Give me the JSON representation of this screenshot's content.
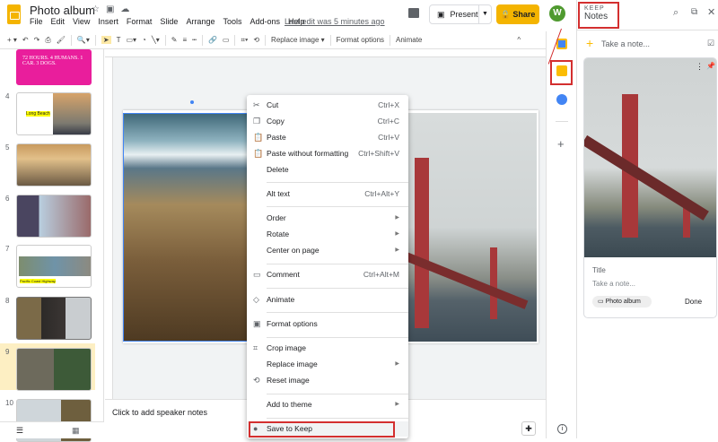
{
  "header": {
    "title": "Photo album",
    "menu": [
      "File",
      "Edit",
      "View",
      "Insert",
      "Format",
      "Slide",
      "Arrange",
      "Tools",
      "Add-ons",
      "Help"
    ],
    "last_edit": "Last edit was 5 minutes ago",
    "present": "Present",
    "share": "Share",
    "avatar": "W"
  },
  "toolbar": {
    "replace_image": "Replace image ▾",
    "format_options": "Format options",
    "animate": "Animate"
  },
  "filmstrip": {
    "slide3_text": "72 HOURS. 4 HUMANS. 1 CAR. 3 DOGS.",
    "slides": [
      {
        "num": "4",
        "caption": "Long Beach"
      },
      {
        "num": "5"
      },
      {
        "num": "6"
      },
      {
        "num": "7",
        "caption": "Pacific Coast Highway"
      },
      {
        "num": "8"
      },
      {
        "num": "9"
      },
      {
        "num": "10"
      }
    ]
  },
  "notes": {
    "placeholder": "Click to add speaker notes"
  },
  "context_menu": [
    {
      "label": "Cut",
      "shortcut": "Ctrl+X",
      "icon": "✂"
    },
    {
      "label": "Copy",
      "shortcut": "Ctrl+C",
      "icon": "❐"
    },
    {
      "label": "Paste",
      "shortcut": "Ctrl+V",
      "icon": "📋"
    },
    {
      "label": "Paste without formatting",
      "shortcut": "Ctrl+Shift+V",
      "icon": "📋"
    },
    {
      "label": "Delete"
    },
    {
      "label": "Alt text",
      "shortcut": "Ctrl+Alt+Y"
    },
    {
      "label": "Order",
      "submenu": true
    },
    {
      "label": "Rotate",
      "submenu": true
    },
    {
      "label": "Center on page",
      "submenu": true
    },
    {
      "label": "Comment",
      "shortcut": "Ctrl+Alt+M",
      "icon": "▭"
    },
    {
      "label": "Animate",
      "icon": "◇"
    },
    {
      "label": "Format options",
      "icon": "▣"
    },
    {
      "label": "Crop image",
      "icon": "⌗"
    },
    {
      "label": "Replace image",
      "submenu": true
    },
    {
      "label": "Reset image",
      "icon": "⟲"
    },
    {
      "label": "Add to theme",
      "submenu": true
    },
    {
      "label": "Save to Keep",
      "icon": "●"
    }
  ],
  "keep": {
    "brand": "KEEP",
    "title": "Notes",
    "take_note": "Take a note...",
    "note": {
      "title_placeholder": "Title",
      "body_placeholder": "Take a note...",
      "chip": "Photo album",
      "done": "Done"
    }
  }
}
